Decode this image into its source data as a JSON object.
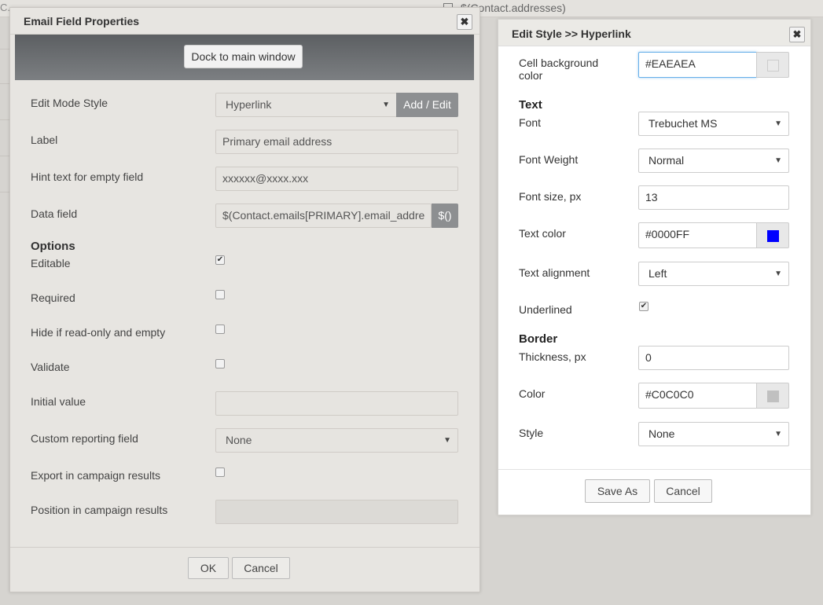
{
  "background": {
    "left_text": "C.",
    "top_text": "$(Contact.addresses)"
  },
  "email_dialog": {
    "title": "Email Field Properties",
    "dock_label": "Dock to main window",
    "fields": {
      "edit_mode_style": {
        "label": "Edit Mode Style",
        "value": "Hyperlink",
        "addon": "Add / Edit"
      },
      "label": {
        "label": "Label",
        "value": "Primary email address"
      },
      "hint": {
        "label": "Hint text for empty field",
        "value": "xxxxxx@xxxx.xxx"
      },
      "data_field": {
        "label": "Data field",
        "value": "$(Contact.emails[PRIMARY].email_addre",
        "addon": "$()"
      }
    },
    "options_heading": "Options",
    "options": {
      "editable": {
        "label": "Editable",
        "checked": true
      },
      "required": {
        "label": "Required",
        "checked": false
      },
      "hide_if_empty": {
        "label": "Hide if read-only and empty",
        "checked": false
      },
      "validate": {
        "label": "Validate",
        "checked": false
      }
    },
    "initial_value": {
      "label": "Initial value",
      "value": ""
    },
    "custom_reporting": {
      "label": "Custom reporting field",
      "value": "None"
    },
    "export_results": {
      "label": "Export in campaign results",
      "checked": false
    },
    "position_results": {
      "label": "Position in campaign results",
      "value": ""
    },
    "ok_label": "OK",
    "cancel_label": "Cancel"
  },
  "style_dialog": {
    "title": "Edit Style >> Hyperlink",
    "cell_bg": {
      "label_line1": "Cell background",
      "label_line2": "color",
      "value": "#EAEAEA",
      "swatch": "#EAEAEA"
    },
    "text_heading": "Text",
    "font": {
      "label": "Font",
      "value": "Trebuchet MS"
    },
    "font_weight": {
      "label": "Font Weight",
      "value": "Normal"
    },
    "font_size": {
      "label": "Font size, px",
      "value": "13"
    },
    "text_color": {
      "label": "Text color",
      "value": "#0000FF",
      "swatch": "#0000FF"
    },
    "text_align": {
      "label": "Text alignment",
      "value": "Left"
    },
    "underlined": {
      "label": "Underlined",
      "checked": true
    },
    "border_heading": "Border",
    "thickness": {
      "label": "Thickness, px",
      "value": "0"
    },
    "border_color": {
      "label": "Color",
      "value": "#C0C0C0",
      "swatch": "#C0C0C0"
    },
    "border_style": {
      "label": "Style",
      "value": "None"
    },
    "save_as_label": "Save As",
    "cancel_label": "Cancel"
  },
  "icons": {
    "close": "close-icon",
    "dropdown": "chevron-down-icon",
    "checkmark": "check-icon",
    "edit": "edit-icon"
  }
}
